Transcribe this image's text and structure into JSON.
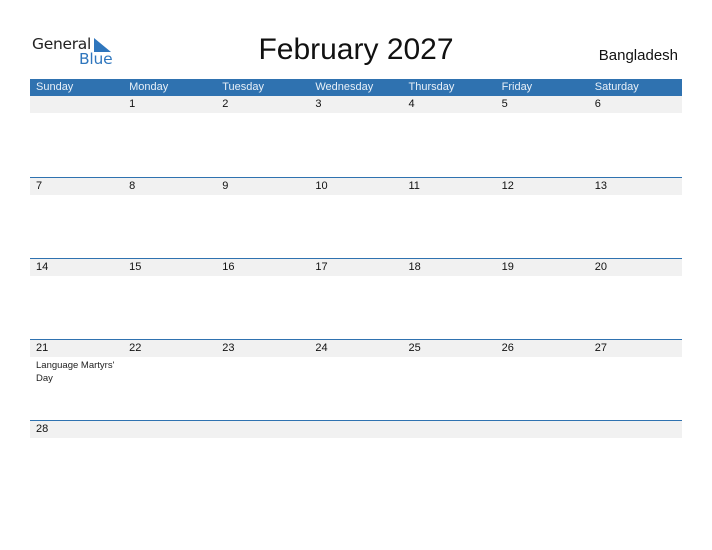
{
  "brand": {
    "name_top": "General",
    "name_bottom": "Blue",
    "accent_color": "#2f76bd"
  },
  "title": "February 2027",
  "country": "Bangladesh",
  "weekdays": [
    "Sunday",
    "Monday",
    "Tuesday",
    "Wednesday",
    "Thursday",
    "Friday",
    "Saturday"
  ],
  "weeks": [
    {
      "days": [
        "",
        "1",
        "2",
        "3",
        "4",
        "5",
        "6"
      ],
      "events": [
        "",
        "",
        "",
        "",
        "",
        "",
        ""
      ]
    },
    {
      "days": [
        "7",
        "8",
        "9",
        "10",
        "11",
        "12",
        "13"
      ],
      "events": [
        "",
        "",
        "",
        "",
        "",
        "",
        ""
      ]
    },
    {
      "days": [
        "14",
        "15",
        "16",
        "17",
        "18",
        "19",
        "20"
      ],
      "events": [
        "",
        "",
        "",
        "",
        "",
        "",
        ""
      ]
    },
    {
      "days": [
        "21",
        "22",
        "23",
        "24",
        "25",
        "26",
        "27"
      ],
      "events": [
        "Language Martyrs' Day",
        "",
        "",
        "",
        "",
        "",
        ""
      ]
    },
    {
      "days": [
        "28",
        "",
        "",
        "",
        "",
        "",
        ""
      ],
      "events": [
        "",
        "",
        "",
        "",
        "",
        "",
        ""
      ]
    }
  ]
}
